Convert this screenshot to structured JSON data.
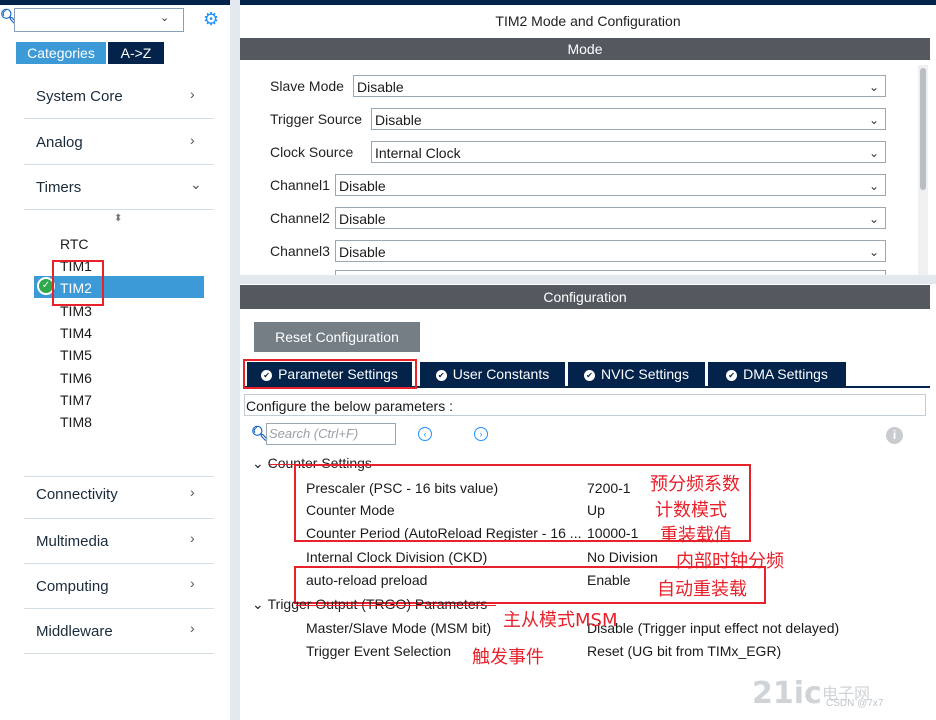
{
  "left_panel": {
    "tabs": [
      "Categories",
      "A->Z"
    ],
    "categories": [
      {
        "label": "System Core"
      },
      {
        "label": "Analog"
      },
      {
        "label": "Timers"
      },
      {
        "label": "Connectivity"
      },
      {
        "label": "Multimedia"
      },
      {
        "label": "Computing"
      },
      {
        "label": "Middleware"
      }
    ],
    "timers": [
      "RTC",
      "TIM1",
      "TIM2",
      "TIM3",
      "TIM4",
      "TIM5",
      "TIM6",
      "TIM7",
      "TIM8"
    ],
    "selected_timer": "TIM2"
  },
  "mode": {
    "title": "TIM2 Mode and Configuration",
    "header": "Mode",
    "fields": [
      {
        "label": "Slave Mode",
        "value": "Disable"
      },
      {
        "label": "Trigger Source",
        "value": "Disable"
      },
      {
        "label": "Clock Source",
        "value": "Internal Clock"
      },
      {
        "label": "Channel1",
        "value": "Disable"
      },
      {
        "label": "Channel2",
        "value": "Disable"
      },
      {
        "label": "Channel3",
        "value": "Disable"
      }
    ]
  },
  "configuration": {
    "header": "Configuration",
    "reset_label": "Reset Configuration",
    "tabs": [
      "Parameter Settings",
      "User Constants",
      "NVIC Settings",
      "DMA Settings"
    ],
    "hint": "Configure the below parameters :",
    "search_placeholder": "Search (Ctrl+F)",
    "groups": [
      {
        "title": "Counter Settings",
        "params": [
          {
            "name": "Prescaler (PSC - 16 bits value)",
            "value": "7200-1"
          },
          {
            "name": "Counter Mode",
            "value": "Up"
          },
          {
            "name": "Counter Period (AutoReload Register - 16 ...",
            "value": "10000-1"
          },
          {
            "name": "Internal Clock Division (CKD)",
            "value": "No Division"
          },
          {
            "name": "auto-reload preload",
            "value": "Enable"
          }
        ]
      },
      {
        "title": "Trigger Output (TRGO) Parameters",
        "params": [
          {
            "name": "Master/Slave Mode (MSM bit)",
            "value": "Disable (Trigger input effect not delayed)"
          },
          {
            "name": "Trigger Event Selection",
            "value": "Reset (UG bit from TIMx_EGR)"
          }
        ]
      }
    ]
  },
  "annotations": [
    "预分频系数",
    "计数模式",
    "重装载值",
    "内部时钟分频",
    "自动重装载",
    "主从模式MSM",
    "触发事件"
  ],
  "watermark": {
    "logo": "21ic",
    "cn": "电子网",
    "sub": "CSDN @7x7"
  },
  "colors": {
    "accent": "#3c9ad6",
    "dark": "#03234b",
    "annotation": "#e8212b"
  }
}
